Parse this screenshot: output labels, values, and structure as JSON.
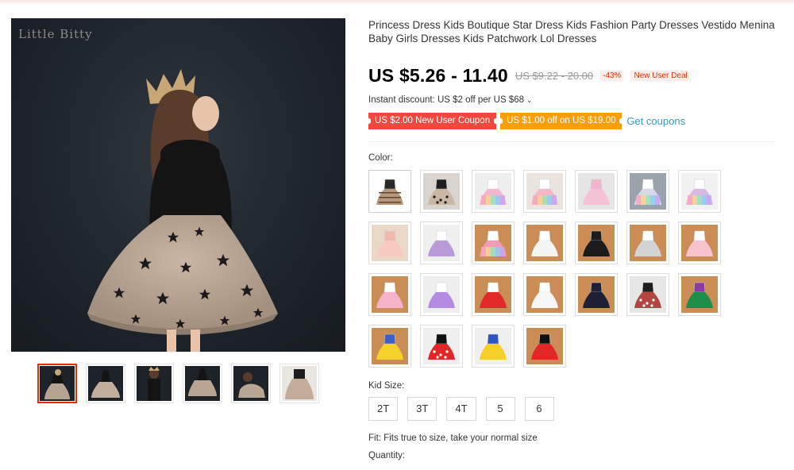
{
  "gallery": {
    "watermark": "Little Bitty",
    "thumbnails": [
      {
        "name": "thumb-1",
        "style": "dark",
        "selected": true
      },
      {
        "name": "thumb-2",
        "style": "dark",
        "selected": false
      },
      {
        "name": "thumb-3",
        "style": "dark",
        "selected": false
      },
      {
        "name": "thumb-4",
        "style": "dark",
        "selected": false
      },
      {
        "name": "thumb-5",
        "style": "dark",
        "selected": false
      },
      {
        "name": "thumb-6",
        "style": "light",
        "selected": false
      }
    ]
  },
  "product": {
    "title": "Princess Dress Kids Boutique Star Dress Kids Fashion Party Dresses Vestido Menina Baby Girls Dresses Kids Patchwork Lol Dresses",
    "price": "US $5.26 - 11.40",
    "original_price": "US $9.22 - 20.00",
    "discount": "-43%",
    "deal_badge": "New User Deal"
  },
  "discounts": {
    "instant": "Instant discount: US $2 off per US $68",
    "instant_chevron": "chevron-down-icon",
    "coupon_red": "US $2.00 New User Coupon",
    "coupon_orange": "US $1.00 off on US $19.00",
    "get_coupons": "Get coupons"
  },
  "colors": {
    "accent": "#e62e04",
    "coupon_red": "#f0483e",
    "coupon_orange": "#f99e0b",
    "link_blue": "#2e9cc3"
  },
  "color_option": {
    "label": "Color:",
    "swatches": [
      {
        "bg": "#ffffff",
        "dress": "#b8977a",
        "top": "#2a2a2a",
        "kind": "layered"
      },
      {
        "bg": "#d9d4cf",
        "dress": "#c9b6a3",
        "top": "#1e1e1e",
        "kind": "star"
      },
      {
        "bg": "#eeeeee",
        "dress": "#f3b5d0",
        "top": "#ffffff",
        "kind": "rainbow"
      },
      {
        "bg": "#e9e4df",
        "dress": "#f7b6c8",
        "top": "#ffffff",
        "kind": "rainbow"
      },
      {
        "bg": "#e5e5e5",
        "dress": "#f5c1d6",
        "top": "#f2b3cd",
        "kind": "pink"
      },
      {
        "bg": "#9aa3ab",
        "dress": "#d8d8e6",
        "top": "#ffffff",
        "kind": "rainbow"
      },
      {
        "bg": "#f1f1f1",
        "dress": "#d9b7e6",
        "top": "#ffffff",
        "kind": "rainbow"
      },
      {
        "bg": "#e9d8c8",
        "dress": "#f7c9c1",
        "top": "#f2b8ae",
        "kind": "pink"
      },
      {
        "bg": "#efefef",
        "dress": "#b89ad8",
        "top": "#ffffff",
        "kind": "purple"
      },
      {
        "bg": "#c98d55",
        "dress": "#f29bb4",
        "top": "#ffffff",
        "kind": "rainbow"
      },
      {
        "bg": "#c98d55",
        "dress": "#f4f4f4",
        "top": "#ffffff",
        "kind": "white"
      },
      {
        "bg": "#c98d55",
        "dress": "#1c1c1c",
        "top": "#1c1c1c",
        "kind": "black"
      },
      {
        "bg": "#c98d55",
        "dress": "#d3d3d3",
        "top": "#ffffff",
        "kind": "white"
      },
      {
        "bg": "#c98d55",
        "dress": "#f6c3cf",
        "top": "#ffffff",
        "kind": "pink"
      },
      {
        "bg": "#c98d55",
        "dress": "#f4b3c9",
        "top": "#ffffff",
        "kind": "pink"
      },
      {
        "bg": "#eeeeee",
        "dress": "#b38be0",
        "top": "#ffffff",
        "kind": "purple"
      },
      {
        "bg": "#c98d55",
        "dress": "#e02a2a",
        "top": "#ffffff",
        "kind": "red"
      },
      {
        "bg": "#c98d55",
        "dress": "#f6f6f6",
        "top": "#ffffff",
        "kind": "white"
      },
      {
        "bg": "#c98d55",
        "dress": "#1f2035",
        "top": "#1f2035",
        "kind": "navy"
      },
      {
        "bg": "#e6e6e6",
        "dress": "#b3453f",
        "top": "#1e1e1e",
        "kind": "print"
      },
      {
        "bg": "#c98d55",
        "dress": "#1f8e4a",
        "top": "#8a3aa5",
        "kind": "green"
      },
      {
        "bg": "#c98d55",
        "dress": "#f5d12a",
        "top": "#3b5fc4",
        "kind": "yellow"
      },
      {
        "bg": "#efefef",
        "dress": "#e22727",
        "top": "#111111",
        "kind": "dots"
      },
      {
        "bg": "#efefef",
        "dress": "#f6cf2a",
        "top": "#2c56c1",
        "kind": "yellow"
      },
      {
        "bg": "#c98d55",
        "dress": "#e22727",
        "top": "#111111",
        "kind": "red"
      }
    ]
  },
  "size_option": {
    "label": "Kid Size:",
    "sizes": [
      "2T",
      "3T",
      "4T",
      "5",
      "6"
    ]
  },
  "fit": "Fit: Fits true to size, take your normal size",
  "quantity_label": "Quantity:"
}
